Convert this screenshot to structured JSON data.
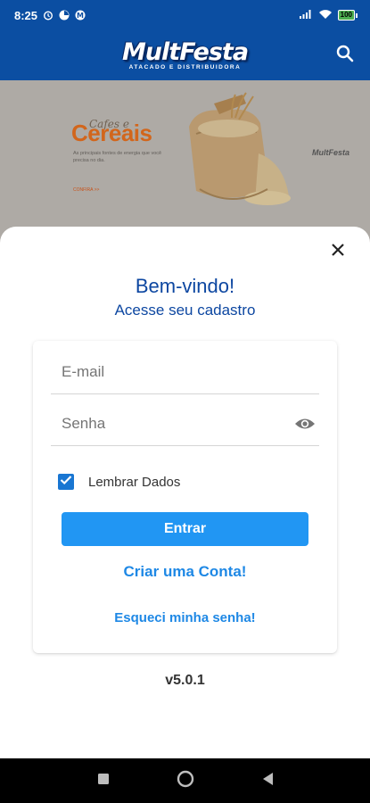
{
  "status_bar": {
    "time": "8:25",
    "battery": "100"
  },
  "app_bar": {
    "logo_text": "MultFesta",
    "logo_tagline": "ATACADO E DISTRIBUIDORA",
    "search_icon": "search-icon"
  },
  "banner": {
    "script_text": "Cafes e",
    "title": "Cereais",
    "body": "As principais fontes de energia que você precisa no dia.",
    "cta": "CONFIRA >>",
    "brand_mark": "MultFesta"
  },
  "login_sheet": {
    "close_icon": "close-icon",
    "welcome": "Bem-vindo!",
    "subtitle": "Acesse seu cadastro",
    "email_placeholder": "E-mail",
    "password_placeholder": "Senha",
    "visibility_icon": "eye-icon",
    "remember_label": "Lembrar Dados",
    "remember_checked": true,
    "enter_button": "Entrar",
    "create_account_link": "Criar uma Conta!",
    "forgot_password_link": "Esqueci minha senha!",
    "version": "v5.0.1"
  },
  "colors": {
    "brand_blue": "#0b4ea2",
    "title_blue": "#0d47a1",
    "button_blue": "#2196f3",
    "link_blue": "#1e88e5",
    "checkbox_blue": "#1976d2"
  }
}
